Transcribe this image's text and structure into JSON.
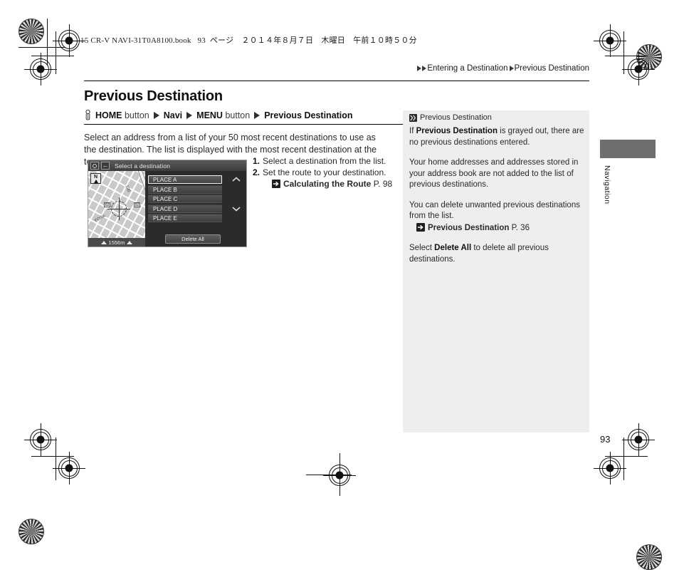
{
  "print": {
    "book_line_prefix": "15 CR-V NAVI-31T0A8100.book",
    "book_line_page": "93",
    "book_line_jp": "ページ　２０１４年８月７日　木曜日　午前１０時５０分"
  },
  "breadcrumb": {
    "parent": "Entering a Destination",
    "current": "Previous Destination"
  },
  "page": {
    "title": "Previous Destination",
    "number": "93",
    "edge_tab_label": "Navigation"
  },
  "navpath": {
    "home_button": "HOME",
    "button_word_1": "button",
    "navi": "Navi",
    "menu_button": "MENU",
    "button_word_2": "button",
    "destination": "Previous Destination"
  },
  "body": {
    "paragraph": "Select an address from a list of your 50 most recent destinations to use as the destination. The list is displayed with the most recent destination at the top."
  },
  "steps": [
    {
      "num": "1.",
      "text": "Select a destination from the list."
    },
    {
      "num": "2.",
      "text": "Set the route to your destination."
    }
  ],
  "step_reference": {
    "label": "Calculating the Route",
    "page": "P. 98"
  },
  "navscreen": {
    "title": "Select a destination",
    "compass_letter": "N",
    "scale": "1556m",
    "map_label_road": "100",
    "map_label_street": "YORK",
    "shield_left": "62",
    "shield_right": "52",
    "items": [
      {
        "label": "PLACE A",
        "selected": true
      },
      {
        "label": "PLACE B",
        "selected": false
      },
      {
        "label": "PLACE C",
        "selected": false
      },
      {
        "label": "PLACE D",
        "selected": false
      },
      {
        "label": "PLACE E",
        "selected": false
      }
    ],
    "delete_all": "Delete All"
  },
  "sidebar": {
    "heading": "Previous Destination",
    "para1_pre": "If ",
    "para1_bold": "Previous Destination",
    "para1_post": " is grayed out, there are no previous destinations entered.",
    "para2": "Your home addresses and addresses stored in your address book are not added to the list of previous destinations.",
    "para3": "You can delete unwanted previous destinations from the list.",
    "reference_label": "Previous Destination",
    "reference_page": "P. 36",
    "para4_pre": "Select ",
    "para4_bold": "Delete All",
    "para4_post": " to delete all previous destinations."
  },
  "colors": {
    "panel_bg": "#eeeeee",
    "tab_gray": "#6e6e6e",
    "screen_dark": "#2b2b2b"
  }
}
